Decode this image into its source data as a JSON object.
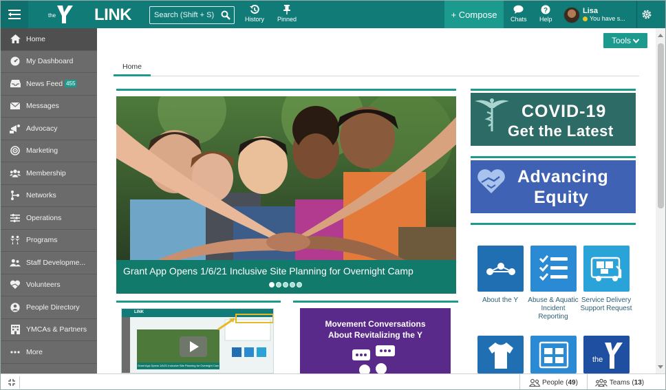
{
  "topbar": {
    "logo_small": "the",
    "logo_text": "LINK",
    "search_placeholder": "Search (Shift + S)",
    "history_label": "History",
    "pinned_label": "Pinned",
    "compose_label": "+ Compose",
    "chats_label": "Chats",
    "help_label": "Help",
    "user_name": "Lisa",
    "user_status": "You have s..."
  },
  "sidebar": {
    "items": [
      {
        "label": "Home",
        "icon": "home-icon"
      },
      {
        "label": "My Dashboard",
        "icon": "dashboard-icon"
      },
      {
        "label": "News Feed",
        "icon": "inbox-icon",
        "badge": "455"
      },
      {
        "label": "Messages",
        "icon": "envelope-icon"
      },
      {
        "label": "Advocacy",
        "icon": "advocacy-icon"
      },
      {
        "label": "Marketing",
        "icon": "target-icon"
      },
      {
        "label": "Membership",
        "icon": "users-icon"
      },
      {
        "label": "Networks",
        "icon": "network-icon"
      },
      {
        "label": "Operations",
        "icon": "sliders-icon"
      },
      {
        "label": "Programs",
        "icon": "children-icon"
      },
      {
        "label": "Staff Developme...",
        "icon": "staff-icon"
      },
      {
        "label": "Volunteers",
        "icon": "heart-hands-icon"
      },
      {
        "label": "People Directory",
        "icon": "person-circle-icon"
      },
      {
        "label": "YMCAs & Partners",
        "icon": "building-icon"
      },
      {
        "label": "More",
        "icon": "more-icon"
      }
    ]
  },
  "main": {
    "tools_label": "Tools",
    "tabs": [
      {
        "label": "Home"
      }
    ],
    "hero": {
      "caption": "Grant App Opens 1/6/21 Inclusive Site Planning for Overnight Camp",
      "slide_count": 5,
      "active_slide": 1
    },
    "covid": {
      "line1": "COVID-19",
      "line2": "Get the Latest"
    },
    "equity": {
      "line1": "Advancing",
      "line2": "Equity"
    },
    "tiles": [
      {
        "label": "About the Y",
        "icon": "network-nodes-icon",
        "color": "#1f6fb2"
      },
      {
        "label": "Abuse & Aquatic Incident Reporting",
        "icon": "checklist-icon",
        "color": "#2b8ad4"
      },
      {
        "label": "Service Delivery Support Request",
        "icon": "truck-icon",
        "color": "#2aa3d8"
      },
      {
        "label": "",
        "icon": "tshirt-icon",
        "color": "#1f6fb2"
      },
      {
        "label": "",
        "icon": "grid-icon",
        "color": "#2b8ad4"
      },
      {
        "label": "",
        "icon": "y-logo-icon",
        "color": "#1f4fa0"
      }
    ],
    "movement": {
      "line1": "Movement Conversations",
      "line2": "About Revitalizing the Y"
    },
    "thumb": {
      "mini_logo": "LINK",
      "mini_caption": "Grant App Opens 1/6/21 Inclusive Site Planning for Overnight Camp"
    }
  },
  "bottombar": {
    "people_label": "People",
    "people_count": "49",
    "teams_label": "Teams",
    "teams_count": "13"
  },
  "colors": {
    "topbar": "#117b78",
    "accent": "#1c9a8e",
    "sidebar": "#6b6b6b",
    "covid": "#2d6b66",
    "equity": "#3f62b4",
    "movement": "#5a2a8a"
  }
}
